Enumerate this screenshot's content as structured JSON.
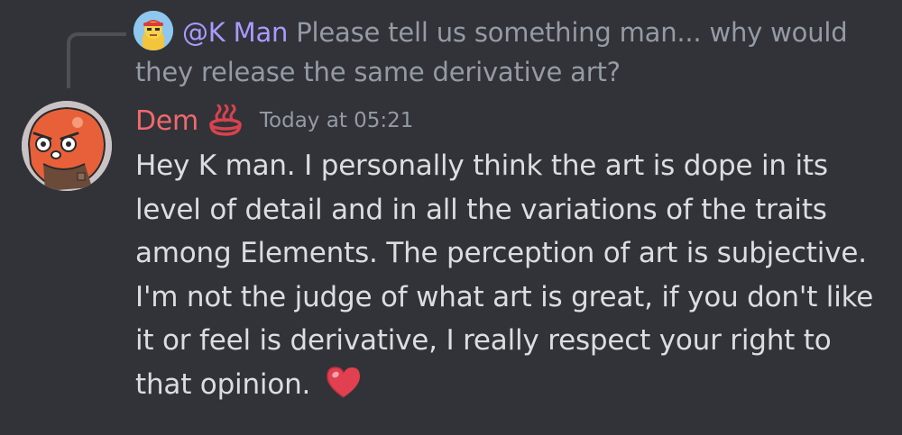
{
  "reply": {
    "author": "@K Man",
    "text": "Please tell us something man... why would they release the same derivative art?"
  },
  "message": {
    "author": "Dem",
    "timestamp": "Today at 05:21",
    "content": "Hey K man. I personally think the art is dope in its level of detail and in all the variations of the traits among Elements. The perception of art is subjective. I'm not the judge of what art is great, if you don't like it or feel is derivative, I really respect your right to that opinion."
  },
  "colors": {
    "background": "#313338",
    "author_name": "#f0696d",
    "reply_mention": "#a79bff",
    "muted_text": "#949ba4",
    "body_text": "#dbdee1",
    "heart": "#e0404f"
  },
  "icons": {
    "role": "hot-springs-icon",
    "emoji": "heart-emoji"
  }
}
